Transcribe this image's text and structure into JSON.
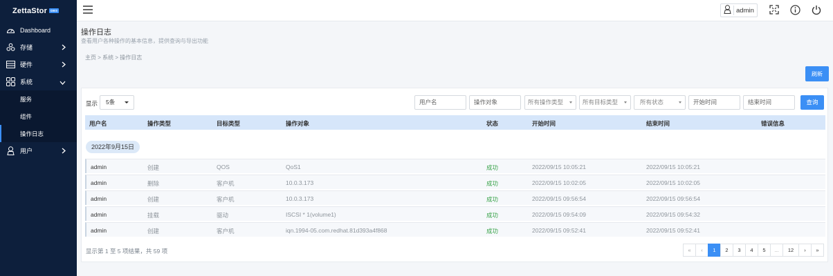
{
  "app": {
    "logo": "ZettaStor",
    "logo_badge": "DBS"
  },
  "sidebar": {
    "items": [
      {
        "label": "Dashboard",
        "icon": "dashboard-icon"
      },
      {
        "label": "存储",
        "icon": "storage-icon"
      },
      {
        "label": "硬件",
        "icon": "hardware-icon"
      },
      {
        "label": "系统",
        "icon": "system-icon"
      },
      {
        "label": "用户",
        "icon": "user-icon"
      }
    ],
    "system_children": [
      "服务",
      "组件",
      "操作日志"
    ],
    "active": "操作日志"
  },
  "topbar": {
    "username": "admin"
  },
  "page": {
    "title": "操作日志",
    "description": "查看用户各种操作的基本信息，提供查询与导出功能",
    "breadcrumb": "主页 > 系统 > 操作日志",
    "refresh_label": "刷新"
  },
  "filters": {
    "show_label": "显示",
    "page_size": "5条",
    "username_placeholder": "用户名",
    "object_placeholder": "操作对象",
    "op_type": "所有操作类型",
    "target_type": "所有目标类型",
    "status": "所有状态",
    "start_placeholder": "开始时间",
    "end_placeholder": "结束时间",
    "query_label": "查询"
  },
  "table": {
    "headers": [
      "用户名",
      "操作类型",
      "目标类型",
      "操作对象",
      "状态",
      "开始时间",
      "结束时间",
      "错误信息"
    ],
    "group_date": "2022年9月15日",
    "rows": [
      {
        "user": "admin",
        "op": "创建",
        "target": "QOS",
        "object": "QoS1",
        "status": "成功",
        "start": "2022/09/15 10:05:21",
        "end": "2022/09/15 10:05:21",
        "error": ""
      },
      {
        "user": "admin",
        "op": "删除",
        "target": "客户机",
        "object": "10.0.3.173",
        "status": "成功",
        "start": "2022/09/15 10:02:05",
        "end": "2022/09/15 10:02:05",
        "error": ""
      },
      {
        "user": "admin",
        "op": "创建",
        "target": "客户机",
        "object": "10.0.3.173",
        "status": "成功",
        "start": "2022/09/15 09:56:54",
        "end": "2022/09/15 09:56:54",
        "error": ""
      },
      {
        "user": "admin",
        "op": "挂载",
        "target": "驱动",
        "object": "ISCSI * 1(volume1)",
        "status": "成功",
        "start": "2022/09/15 09:54:09",
        "end": "2022/09/15 09:54:32",
        "error": ""
      },
      {
        "user": "admin",
        "op": "创建",
        "target": "客户机",
        "object": "iqn.1994-05.com.redhat.81d393a4f868",
        "status": "成功",
        "start": "2022/09/15 09:52:41",
        "end": "2022/09/15 09:52:41",
        "error": ""
      }
    ]
  },
  "footer": {
    "summary": "显示第 1 至 5 项结果，共 59 项",
    "pages": [
      "«",
      "‹",
      "1",
      "2",
      "3",
      "4",
      "5",
      "...",
      "12",
      "›",
      "»"
    ],
    "current_page": "1"
  }
}
